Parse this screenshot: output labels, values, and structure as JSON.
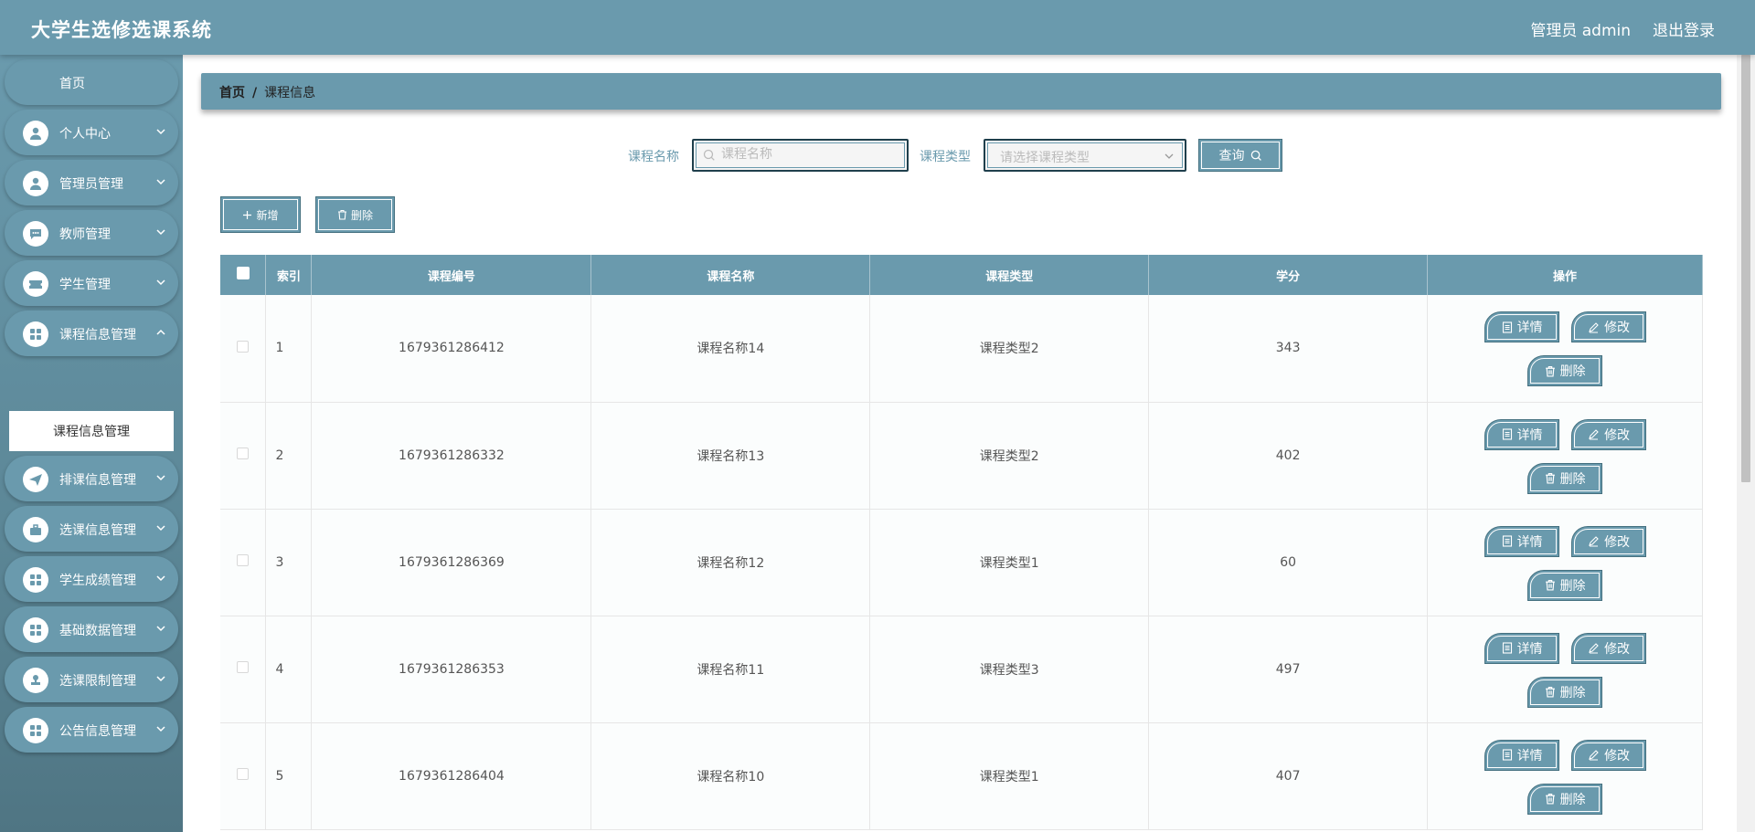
{
  "header": {
    "title": "大学生选修选课系统",
    "user": "管理员 admin",
    "logout": "退出登录"
  },
  "sidebar": {
    "home": "首页",
    "items": [
      {
        "label": "个人中心",
        "icon": "user-icon"
      },
      {
        "label": "管理员管理",
        "icon": "user-icon"
      },
      {
        "label": "教师管理",
        "icon": "chat-icon"
      },
      {
        "label": "学生管理",
        "icon": "ticket-icon"
      },
      {
        "label": "课程信息管理",
        "icon": "grid-icon"
      },
      {
        "label": "排课信息管理",
        "icon": "send-icon"
      },
      {
        "label": "选课信息管理",
        "icon": "suitcase-icon"
      },
      {
        "label": "学生成绩管理",
        "icon": "grid-icon"
      },
      {
        "label": "基础数据管理",
        "icon": "grid-icon"
      },
      {
        "label": "选课限制管理",
        "icon": "stamp-icon"
      },
      {
        "label": "公告信息管理",
        "icon": "grid-icon"
      }
    ],
    "active_sub": "课程信息管理"
  },
  "breadcrumb": {
    "home": "首页",
    "sep": "/",
    "current": "课程信息"
  },
  "search": {
    "name_label": "课程名称",
    "name_placeholder": "课程名称",
    "type_label": "课程类型",
    "type_placeholder": "请选择课程类型",
    "query_label": "查询"
  },
  "actions": {
    "add_label": "新增",
    "delete_label": "删除"
  },
  "table": {
    "headers": [
      "",
      "索引",
      "课程编号",
      "课程名称",
      "课程类型",
      "学分",
      "操作"
    ],
    "rows": [
      {
        "index": "1",
        "code": "1679361286412",
        "name": "课程名称14",
        "type": "课程类型2",
        "credit": "343"
      },
      {
        "index": "2",
        "code": "1679361286332",
        "name": "课程名称13",
        "type": "课程类型2",
        "credit": "402"
      },
      {
        "index": "3",
        "code": "1679361286369",
        "name": "课程名称12",
        "type": "课程类型1",
        "credit": "60"
      },
      {
        "index": "4",
        "code": "1679361286353",
        "name": "课程名称11",
        "type": "课程类型3",
        "credit": "497"
      },
      {
        "index": "5",
        "code": "1679361286404",
        "name": "课程名称10",
        "type": "课程类型1",
        "credit": "407"
      }
    ],
    "op_detail": "详情",
    "op_edit": "修改",
    "op_delete": "删除"
  },
  "colors": {
    "primary": "#6a9aad",
    "border_dark": "#1f3f4c",
    "sidebar_bottom": "#4f7583"
  }
}
